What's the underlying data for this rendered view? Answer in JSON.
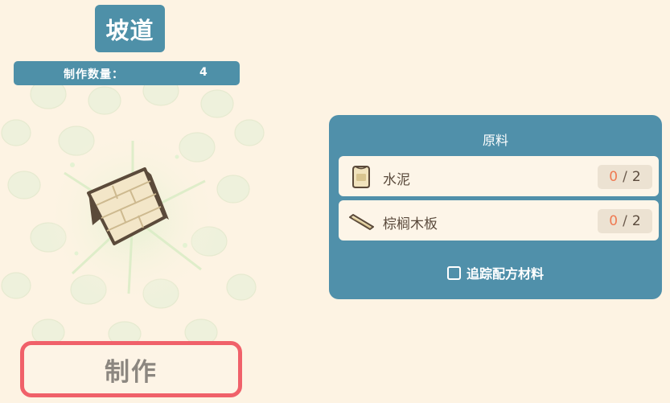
{
  "item": {
    "title": "坡道",
    "quantity_label": "制作数量：",
    "quantity_value": "4",
    "icon": "ramp-icon"
  },
  "craft_button_label": "制作",
  "materials": {
    "title": "原料",
    "items": [
      {
        "name": "水泥",
        "have": "0",
        "need": "2",
        "icon": "cement-bag-icon"
      },
      {
        "name": "棕榈木板",
        "have": "0",
        "need": "2",
        "icon": "palm-plank-icon"
      }
    ],
    "separator": "/",
    "track_label": "追踪配方材料",
    "track_checked": false
  },
  "colors": {
    "panel": "#5090aa",
    "header": "#4e90a8",
    "background": "#fdf3e3",
    "craft_border": "#f0616a",
    "have_count": "#ef7a52"
  }
}
